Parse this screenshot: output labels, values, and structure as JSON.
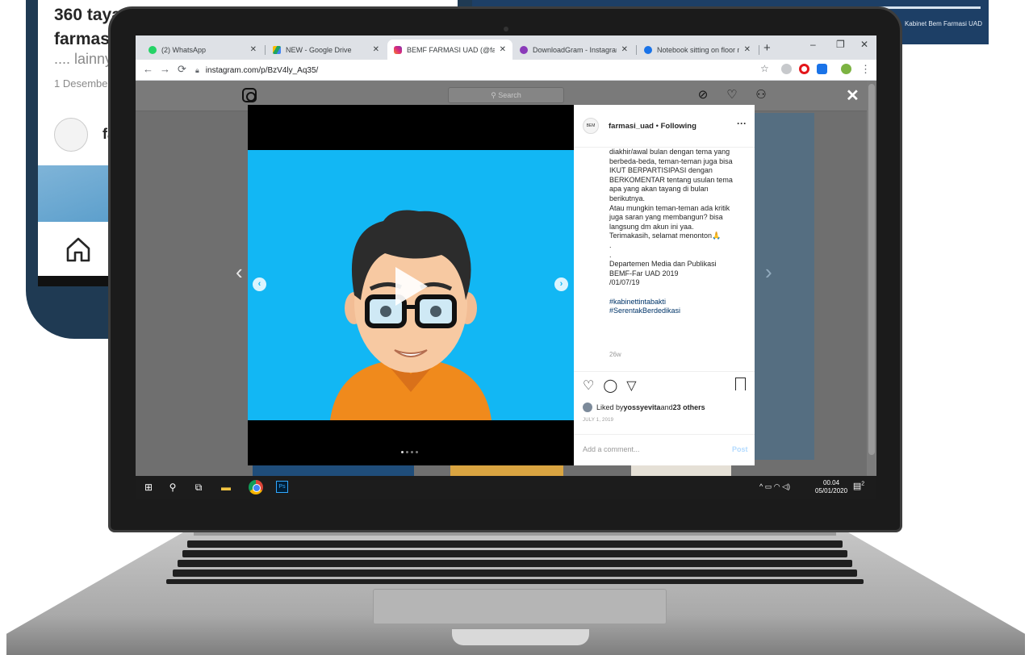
{
  "background": {
    "phone": {
      "title_line1": "360 taya",
      "title_line2": "farmasi",
      "subtitle": ".... lainny",
      "date": "1 Desembe",
      "handle": "fa"
    },
    "banner_text": "Kabinet Bem Farmasi UAD"
  },
  "browser": {
    "tabs": [
      {
        "title": "(2) WhatsApp",
        "icon": "whatsapp-icon",
        "color": "#25d366"
      },
      {
        "title": "NEW - Google Drive",
        "icon": "google-drive-icon",
        "color": "#1fa463"
      },
      {
        "title": "BEMF FARMASI UAD (@farmas",
        "icon": "instagram-icon",
        "color": "#e1306c"
      },
      {
        "title": "DownloadGram - Instagram p",
        "icon": "downloadgram-icon",
        "color": "#8a3ab9"
      },
      {
        "title": "Notebook sitting on floor mo",
        "icon": "pixabay-icon",
        "color": "#1a73e8"
      }
    ],
    "new_tab_label": "+",
    "address": "instagram.com/p/BzV4ly_Aq35/"
  },
  "instagram": {
    "search_placeholder": "Search",
    "close_label": "✕",
    "username": "farmasi_uad",
    "follow_separator": "•",
    "follow_status": "Following",
    "more_label": "···",
    "caption_lines": [
      "diakhir/awal bulan dengan tema yang",
      "berbeda-beda, teman-teman juga bisa",
      "IKUT BERPARTISIPASI dengan",
      "BERKOMENTAR tentang usulan tema",
      "apa yang akan tayang di bulan",
      "berikutnya.",
      "Atau mungkin teman-teman ada kritik",
      "juga saran yang membangun? bisa",
      "langsung dm akun ini yaa.",
      "Terimakasih, selamat menonton🙏",
      ".",
      ".",
      "Departemen Media dan Publikasi",
      "BEMF-Far UAD 2019",
      "/01/07/19",
      ""
    ],
    "hashtags": [
      "#kabinettintabakti",
      "#SerentakBerdedikasi"
    ],
    "post_age": "26w",
    "liked_prefix": "Liked by ",
    "liked_user": "yossyevita",
    "liked_middle": " and ",
    "liked_others": "23 others",
    "post_date": "JULY 1, 2019",
    "comment_placeholder": "Add a comment...",
    "post_button": "Post",
    "carousel_count": 4,
    "carousel_active": 1
  },
  "taskbar": {
    "clock_time": "00.04",
    "clock_date": "05/01/2020",
    "notifications": "2",
    "ps_label": "Ps"
  }
}
